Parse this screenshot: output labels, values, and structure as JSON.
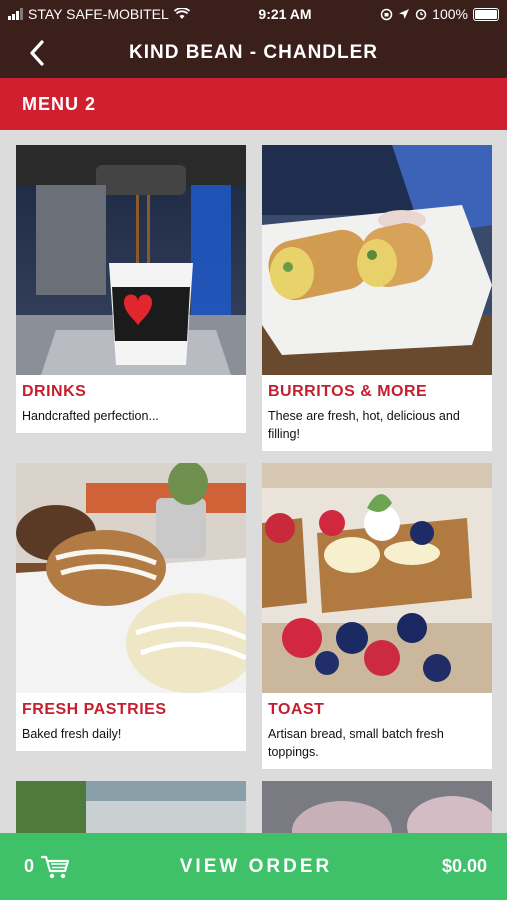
{
  "status_bar": {
    "carrier": "STAY SAFE-MOBITEL",
    "time": "9:21 AM",
    "battery": "100%"
  },
  "nav": {
    "title": "KIND BEAN - CHANDLER"
  },
  "menu": {
    "title": "MENU 2"
  },
  "cards": [
    {
      "title": "DRINKS",
      "description": "Handcrafted perfection..."
    },
    {
      "title": "BURRITOS & MORE",
      "description": "These are fresh, hot, delicious and filling!"
    },
    {
      "title": "FRESH PASTRIES",
      "description": "Baked fresh daily!"
    },
    {
      "title": "TOAST",
      "description": "Artisan bread, small batch fresh toppings."
    }
  ],
  "bottom_bar": {
    "cart_count": "0",
    "view_order_label": "VIEW ORDER",
    "total": "$0.00"
  },
  "colors": {
    "header": "#3a1f1b",
    "menu_bar": "#d0202f",
    "card_title": "#c41f2e",
    "bottom_bar": "#3fc169"
  }
}
